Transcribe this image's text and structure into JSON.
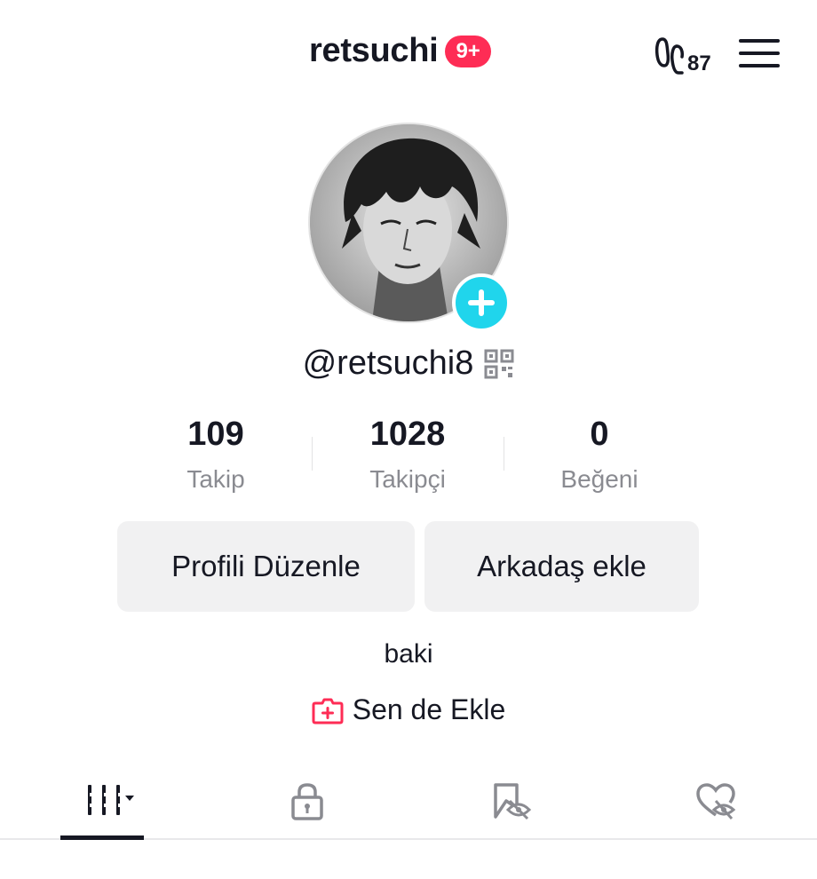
{
  "header": {
    "username": "retsuchi",
    "notification_badge": "9+",
    "footprint_icon": "footprint-icon",
    "footprint_count": "87",
    "menu_icon": "hamburger-menu-icon"
  },
  "profile": {
    "avatar_icon": "avatar",
    "add_icon": "plus-icon",
    "handle": "@retsuchi8",
    "qr_icon": "qr-code-icon"
  },
  "stats": [
    {
      "value": "109",
      "label": "Takip"
    },
    {
      "value": "1028",
      "label": "Takipçi"
    },
    {
      "value": "0",
      "label": "Beğeni"
    }
  ],
  "buttons": {
    "edit_profile": "Profili Düzenle",
    "add_friend": "Arkadaş ekle"
  },
  "bio": "baki",
  "add_link": {
    "icon": "add-box-icon",
    "label": "Sen de Ekle"
  },
  "tabs": [
    {
      "name": "videos-grid-icon",
      "active": true
    },
    {
      "name": "lock-icon",
      "active": false
    },
    {
      "name": "saved-hidden-icon",
      "active": false
    },
    {
      "name": "liked-hidden-icon",
      "active": false
    }
  ],
  "colors": {
    "accent_red": "#fe2c55",
    "accent_cyan": "#20d5ec",
    "text_primary": "#161823",
    "text_secondary": "#8a8b91",
    "button_bg": "#f1f1f2"
  }
}
